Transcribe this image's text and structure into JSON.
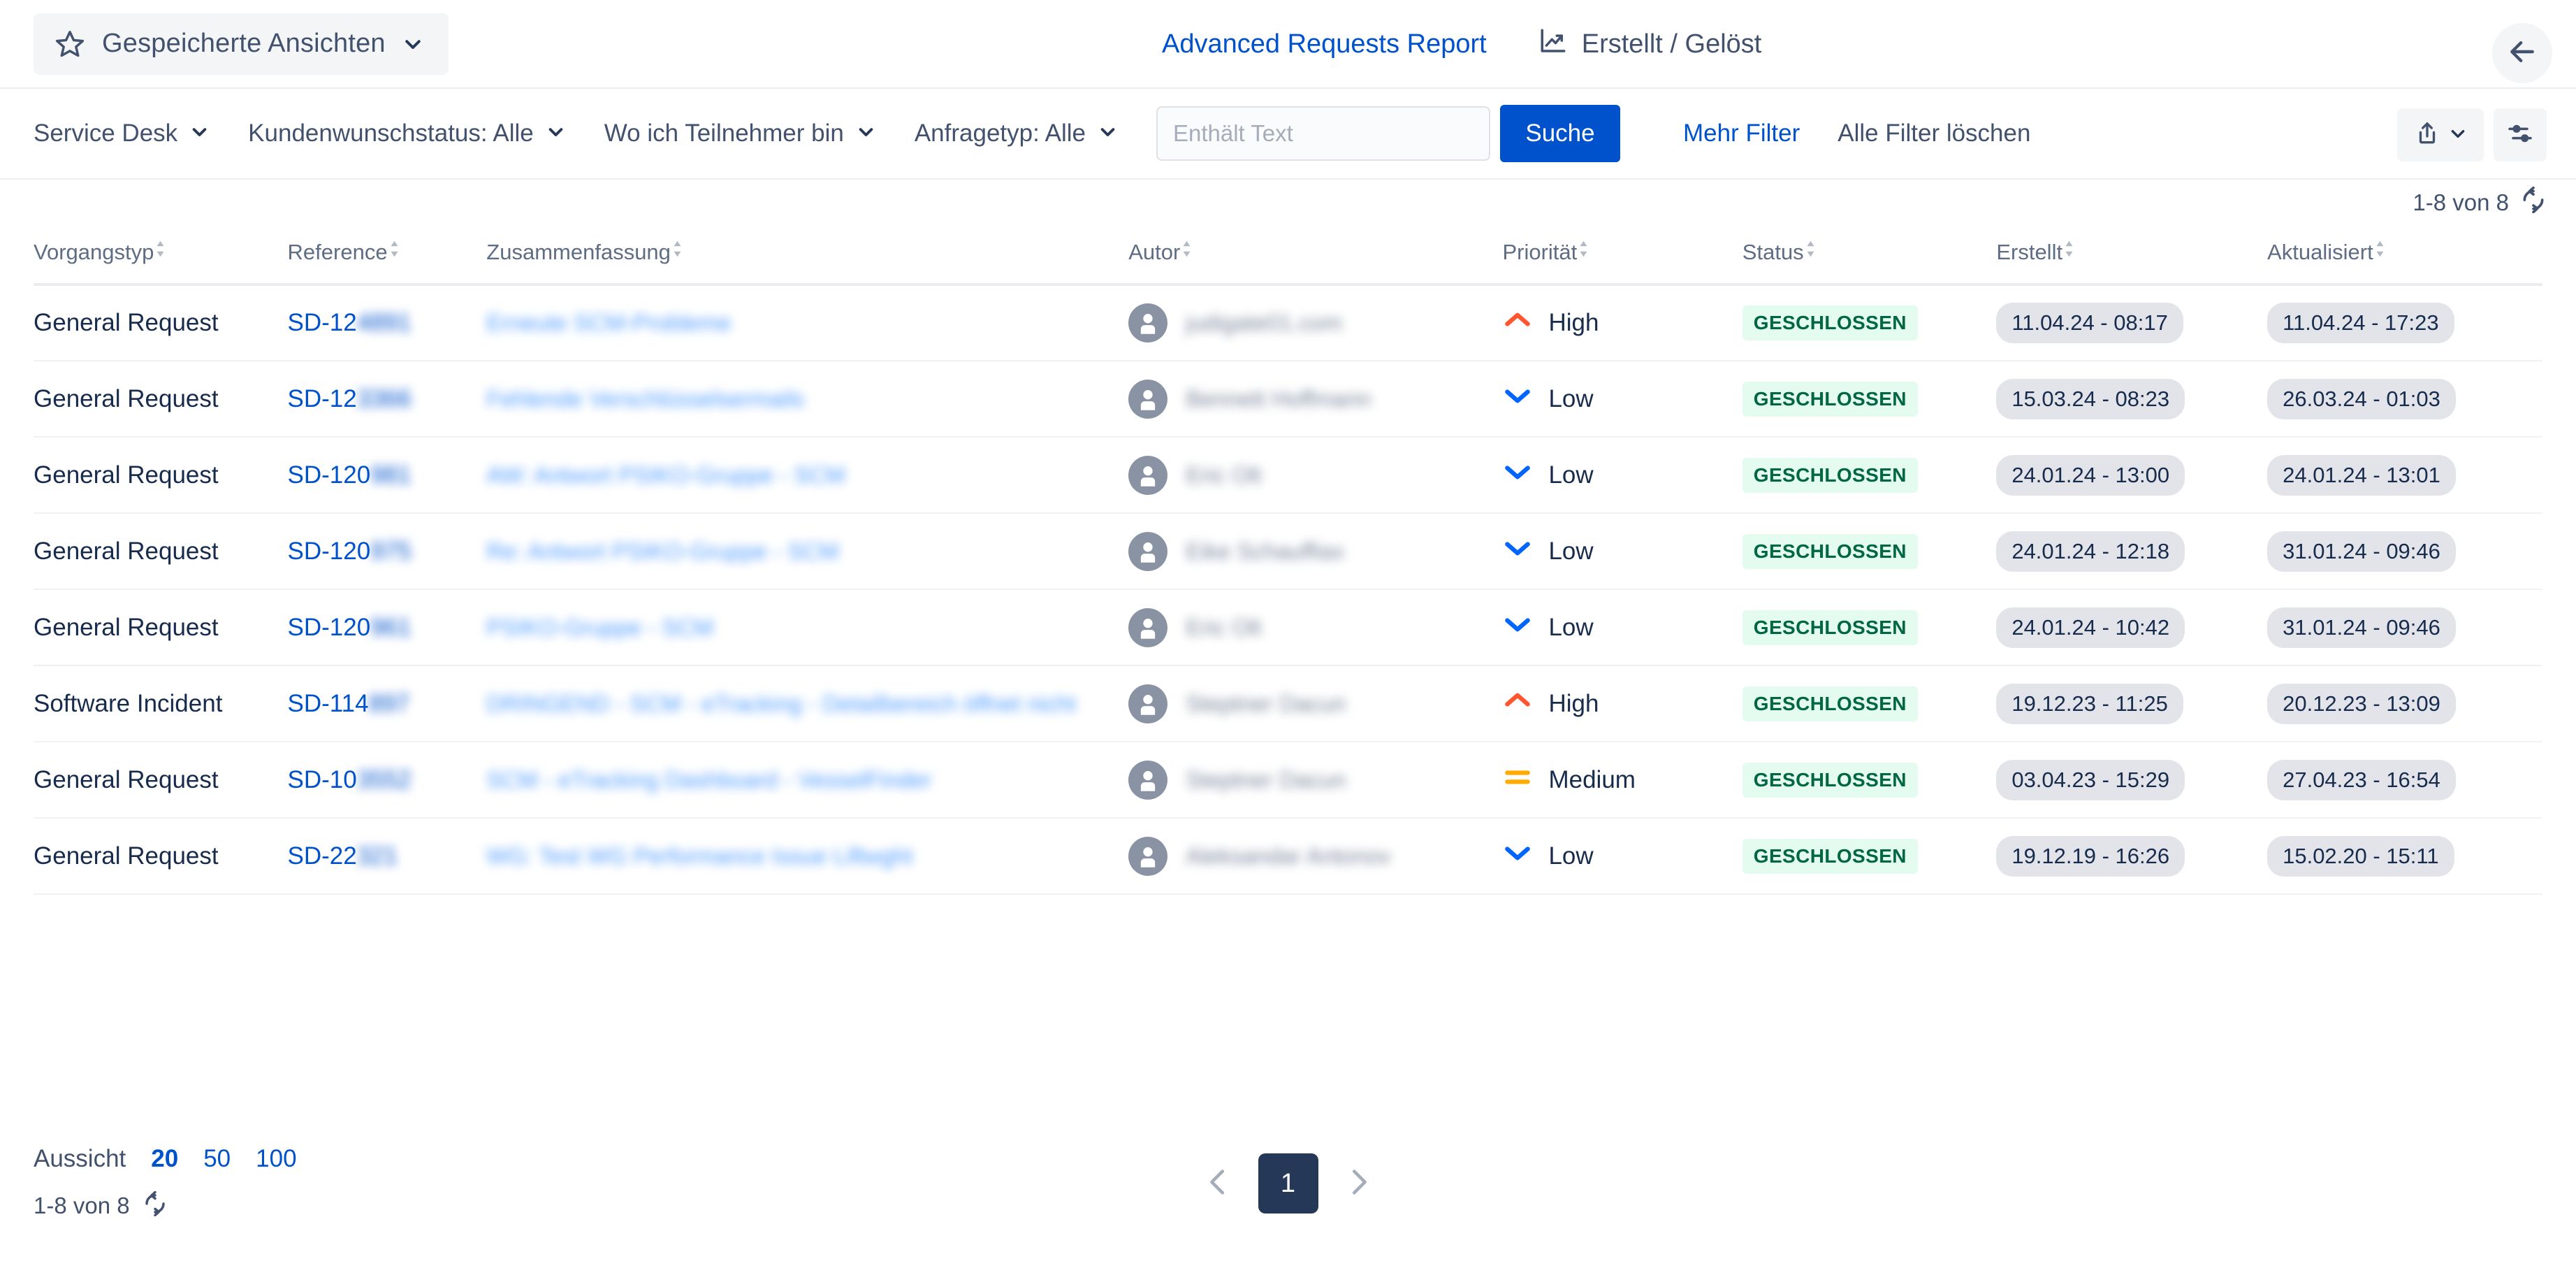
{
  "header": {
    "saved_views_label": "Gespeicherte Ansichten",
    "report_link": "Advanced Requests Report",
    "created_resolved_label": "Erstellt / Gelöst",
    "back_icon": "arrow-left-icon",
    "star_icon": "star-icon",
    "chart_icon": "line-chart-icon"
  },
  "filters": {
    "service_desk": "Service Desk",
    "customer_status": "Kundenwunschstatus: Alle",
    "participant": "Wo ich Teilnehmer bin",
    "request_type": "Anfragetyp: Alle",
    "search_placeholder": "Enthält Text",
    "search_value": "",
    "search_button": "Suche",
    "more_filters": "Mehr Filter",
    "clear_filters": "Alle Filter löschen",
    "export_icon": "export-icon",
    "settings_icon": "sliders-icon"
  },
  "result_count": {
    "top": "1-8 von 8",
    "bottom": "1-8 von 8",
    "refresh_icon": "refresh-icon"
  },
  "table": {
    "columns": [
      "Vorgangstyp",
      "Reference",
      "Zusammenfassung",
      "Autor",
      "Priorität",
      "Status",
      "Erstellt",
      "Aktualisiert"
    ],
    "rows": [
      {
        "type": "General Request",
        "ref_visible": "SD-12",
        "ref_redacted": "4891",
        "summary_redacted": "Erneute SCM-Probleme",
        "author_redacted": "judigate01.com",
        "priority": "High",
        "priority_icon": "priority-high-icon",
        "status": "GESCHLOSSEN",
        "created": "11.04.24 - 08:17",
        "updated": "11.04.24 - 17:23"
      },
      {
        "type": "General Request",
        "ref_visible": "SD-12",
        "ref_redacted": "3366",
        "summary_redacted": "Fehlende Verschlüsselsermails",
        "author_redacted": "Bennett Hoffmann",
        "priority": "Low",
        "priority_icon": "priority-low-icon",
        "status": "GESCHLOSSEN",
        "created": "15.03.24 - 08:23",
        "updated": "26.03.24 - 01:03"
      },
      {
        "type": "General Request",
        "ref_visible": "SD-120",
        "ref_redacted": "981",
        "summary_redacted": "AW: Antwort PSIKO-Gruppe - SCM",
        "author_redacted": "Eric Olt",
        "priority": "Low",
        "priority_icon": "priority-low-icon",
        "status": "GESCHLOSSEN",
        "created": "24.01.24 - 13:00",
        "updated": "24.01.24 - 13:01"
      },
      {
        "type": "General Request",
        "ref_visible": "SD-120",
        "ref_redacted": "975",
        "summary_redacted": "Re: Antwort PSIKO-Gruppe - SCM",
        "author_redacted": "Eike Schauffiax",
        "priority": "Low",
        "priority_icon": "priority-low-icon",
        "status": "GESCHLOSSEN",
        "created": "24.01.24 - 12:18",
        "updated": "31.01.24 - 09:46"
      },
      {
        "type": "General Request",
        "ref_visible": "SD-120",
        "ref_redacted": "961",
        "summary_redacted": "PSIKO-Gruppe - SCM",
        "author_redacted": "Eric Olt",
        "priority": "Low",
        "priority_icon": "priority-low-icon",
        "status": "GESCHLOSSEN",
        "created": "24.01.24 - 10:42",
        "updated": "31.01.24 - 09:46"
      },
      {
        "type": "Software Incident",
        "ref_visible": "SD-114",
        "ref_redacted": "897",
        "summary_redacted": "DRINGEND - SCM - eTracking - Detailbereich öffnet nicht",
        "author_redacted": "Steptner Dacun",
        "priority": "High",
        "priority_icon": "priority-high-icon",
        "status": "GESCHLOSSEN",
        "created": "19.12.23 - 11:25",
        "updated": "20.12.23 - 13:09"
      },
      {
        "type": "General Request",
        "ref_visible": "SD-10",
        "ref_redacted": "3552",
        "summary_redacted": "SCM - eTracking Dashboard - VesselFinder",
        "author_redacted": "Steptner Dacun",
        "priority": "Medium",
        "priority_icon": "priority-medium-icon",
        "status": "GESCHLOSSEN",
        "created": "03.04.23 - 15:29",
        "updated": "27.04.23 - 16:54"
      },
      {
        "type": "General Request",
        "ref_visible": "SD-22",
        "ref_redacted": "321",
        "summary_redacted": "WG: Test WG Performance Issue Liftwght",
        "author_redacted": "Aleksandar Antonov",
        "priority": "Low",
        "priority_icon": "priority-low-icon",
        "status": "GESCHLOSSEN",
        "created": "19.12.19 - 16:26",
        "updated": "15.02.20 - 15:11"
      }
    ]
  },
  "footer": {
    "view_label": "Aussicht",
    "page_sizes": [
      "20",
      "50",
      "100"
    ],
    "active_page_size": "20",
    "current_page": "1",
    "prev_icon": "chevron-left-icon",
    "next_icon": "chevron-right-icon"
  },
  "colors": {
    "link": "#0052cc",
    "primary_button": "#0052cc",
    "status_badge_bg": "#e3fcef",
    "status_badge_text": "#006644",
    "priority_high": "#ff5630",
    "priority_medium": "#ffab00",
    "priority_low": "#0065ff",
    "pager_active": "#253858"
  }
}
